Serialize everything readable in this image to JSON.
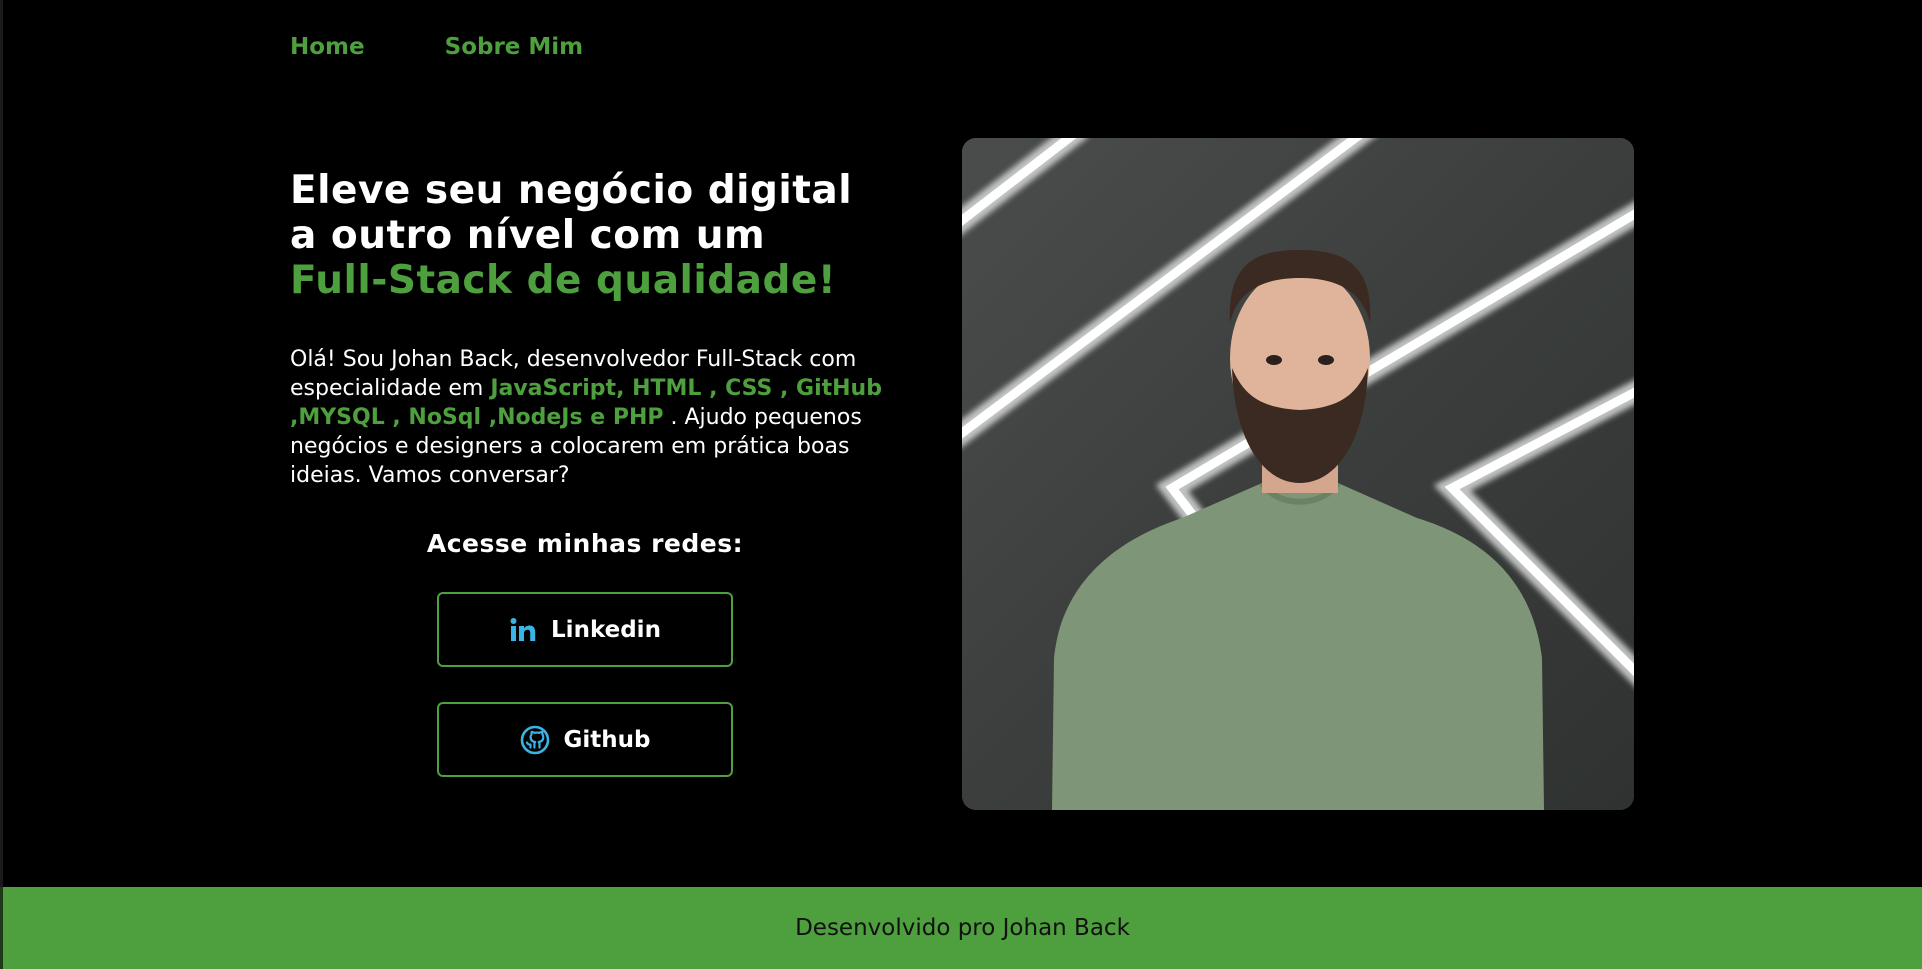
{
  "nav": {
    "items": [
      {
        "label": "Home"
      },
      {
        "label": "Sobre Mim"
      }
    ]
  },
  "hero": {
    "title_line1": "Eleve seu negócio digital",
    "title_line2": "a outro nível com um",
    "title_accent": "Full-Stack de qualidade!",
    "intro_part1": "Olá! Sou Johan Back, desenvolvedor Full-Stack com especialidade em ",
    "intro_skills": "JavaScript, HTML , CSS , GitHub ,MYSQL , NoSql ,NodeJs e PHP",
    "intro_part2": " . Ajudo pequenos negócios e designers a colocarem em prática boas ideias. Vamos conversar?"
  },
  "social": {
    "title": "Acesse minhas redes:",
    "buttons": [
      {
        "label": "Linkedin",
        "icon": "linkedin-icon"
      },
      {
        "label": "Github",
        "icon": "github-icon"
      }
    ]
  },
  "footer": {
    "text": "Desenvolvido pro Johan Back"
  },
  "colors": {
    "background": "#000000",
    "accent": "#4e9f3d",
    "text": "#ffffff",
    "icon_blue": "#3ab4e6"
  }
}
